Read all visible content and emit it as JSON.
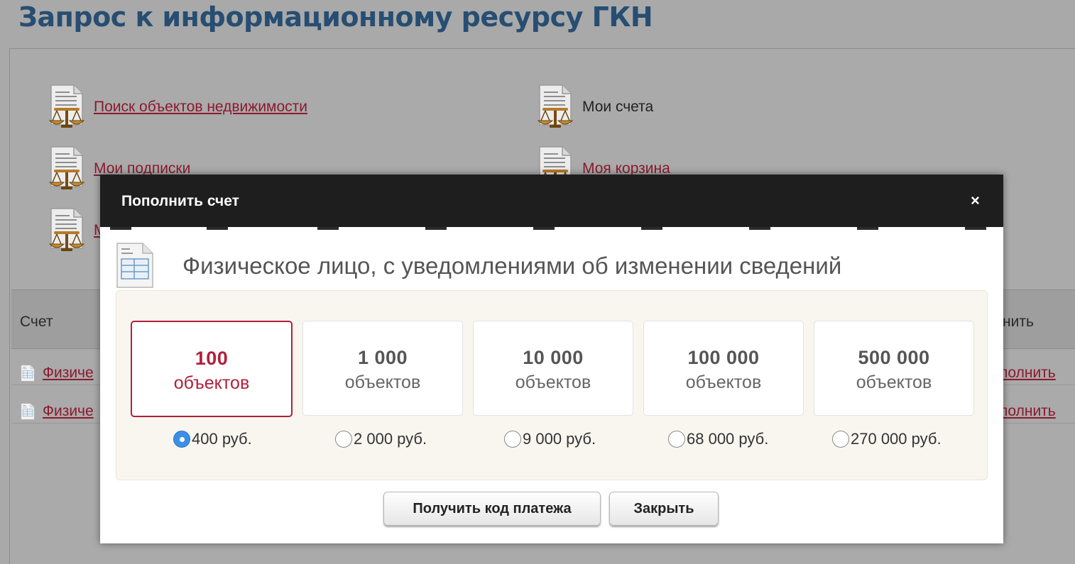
{
  "page": {
    "title": "Запрос к информационному ресурсу ГКН"
  },
  "menu": {
    "search_label": "Поиск объектов недвижимости",
    "accounts_label": "Мои счета",
    "subscriptions_label": "Мои подписки",
    "cart_label": "Моя корзина",
    "third_left_label": "М"
  },
  "table": {
    "header_left": "Счет",
    "header_right": "нить",
    "rows": [
      {
        "name": "Физиче",
        "action": "полнить"
      },
      {
        "name": "Физиче",
        "action": "полнить"
      }
    ]
  },
  "modal": {
    "title": "Пополнить счет",
    "close_glyph": "×",
    "tariff_title": "Физическое лицо, с уведомлениями об изменении сведений",
    "options": [
      {
        "count": "100",
        "unit": "объектов",
        "price": "400 руб.",
        "selected": true
      },
      {
        "count": "1 000",
        "unit": "объектов",
        "price": "2 000 руб.",
        "selected": false
      },
      {
        "count": "10 000",
        "unit": "объектов",
        "price": "9 000 руб.",
        "selected": false
      },
      {
        "count": "100 000",
        "unit": "объектов",
        "price": "68 000 руб.",
        "selected": false
      },
      {
        "count": "500 000",
        "unit": "объектов",
        "price": "270 000 руб.",
        "selected": false
      }
    ],
    "get_code_label": "Получить код платежа",
    "close_label": "Закрыть"
  },
  "colors": {
    "title_blue": "#274e72",
    "link_red": "#8b1a2e",
    "selected_red": "#b0203c",
    "radio_blue": "#3d8fe6",
    "modal_header": "#1e1e1e"
  }
}
